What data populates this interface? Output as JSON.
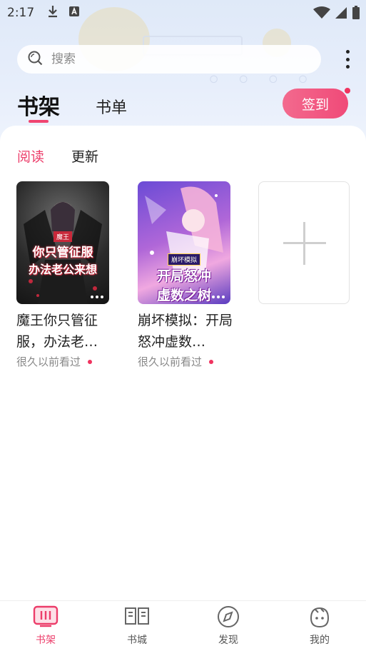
{
  "status_bar": {
    "time": "2:17"
  },
  "search": {
    "placeholder": "搜索"
  },
  "top_tabs": [
    {
      "label": "书架",
      "active": true
    },
    {
      "label": "书单",
      "active": false
    }
  ],
  "signin": {
    "label": "签到",
    "has_badge": true
  },
  "sub_tabs": [
    {
      "label": "阅读",
      "active": true
    },
    {
      "label": "更新",
      "active": false
    }
  ],
  "books": [
    {
      "title": "魔王你只管征服，办法老…",
      "cover_text_main": "你只管征服",
      "cover_text_sub": "办法老公来想",
      "cover_text_tag": "魔王",
      "meta": "很久以前看过",
      "unread_dot": true
    },
    {
      "title": "崩坏模拟：开局怒冲虚数…",
      "cover_text_main": "开局怒冲",
      "cover_text_sub": "虚数之树",
      "cover_text_tag": "崩坏模拟",
      "meta": "很久以前看过",
      "unread_dot": true
    }
  ],
  "bottom_nav": [
    {
      "label": "书架",
      "icon": "bookshelf-icon",
      "active": true
    },
    {
      "label": "书城",
      "icon": "book-store-icon",
      "active": false
    },
    {
      "label": "发现",
      "icon": "compass-icon",
      "active": false
    },
    {
      "label": "我的",
      "icon": "profile-icon",
      "active": false
    }
  ],
  "colors": {
    "accent": "#ec3d6a",
    "header_bg": "#e3ebf9"
  }
}
